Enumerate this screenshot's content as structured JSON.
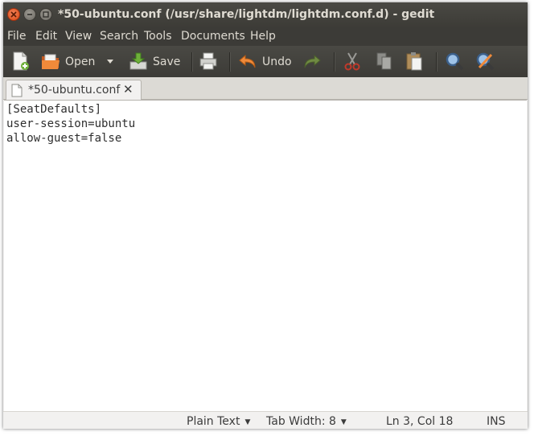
{
  "window": {
    "title": "*50-ubuntu.conf (/usr/share/lightdm/lightdm.conf.d) - gedit"
  },
  "menubar": {
    "items": [
      "File",
      "Edit",
      "View",
      "Search",
      "Tools",
      "Documents",
      "Help"
    ]
  },
  "toolbar": {
    "new_icon": "new-document-icon",
    "open_label": "Open",
    "open_dropdown_icon": "dropdown-arrow-icon",
    "save_label": "Save",
    "print_icon": "printer-icon",
    "undo_label": "Undo",
    "redo_icon": "redo-icon",
    "cut_icon": "scissors-icon",
    "copy_icon": "copy-icon",
    "paste_icon": "paste-icon",
    "find_icon": "magnifier-icon",
    "replace_icon": "find-replace-icon"
  },
  "tabs": [
    {
      "label": "*50-ubuntu.conf",
      "close": "✕"
    }
  ],
  "document": {
    "lines": [
      "[SeatDefaults]",
      "user-session=ubuntu",
      "allow-guest=false"
    ]
  },
  "statusbar": {
    "language": "Plain Text",
    "tab_width": "Tab Width: 8",
    "position": "Ln 3, Col 18",
    "mode": "INS"
  },
  "colors": {
    "titlebar": "#3d3c37",
    "close_button": "#e3541d",
    "menu_text": "#dfdbd2",
    "editor_bg": "#ffffff",
    "window_bg": "#f2f1f0"
  }
}
